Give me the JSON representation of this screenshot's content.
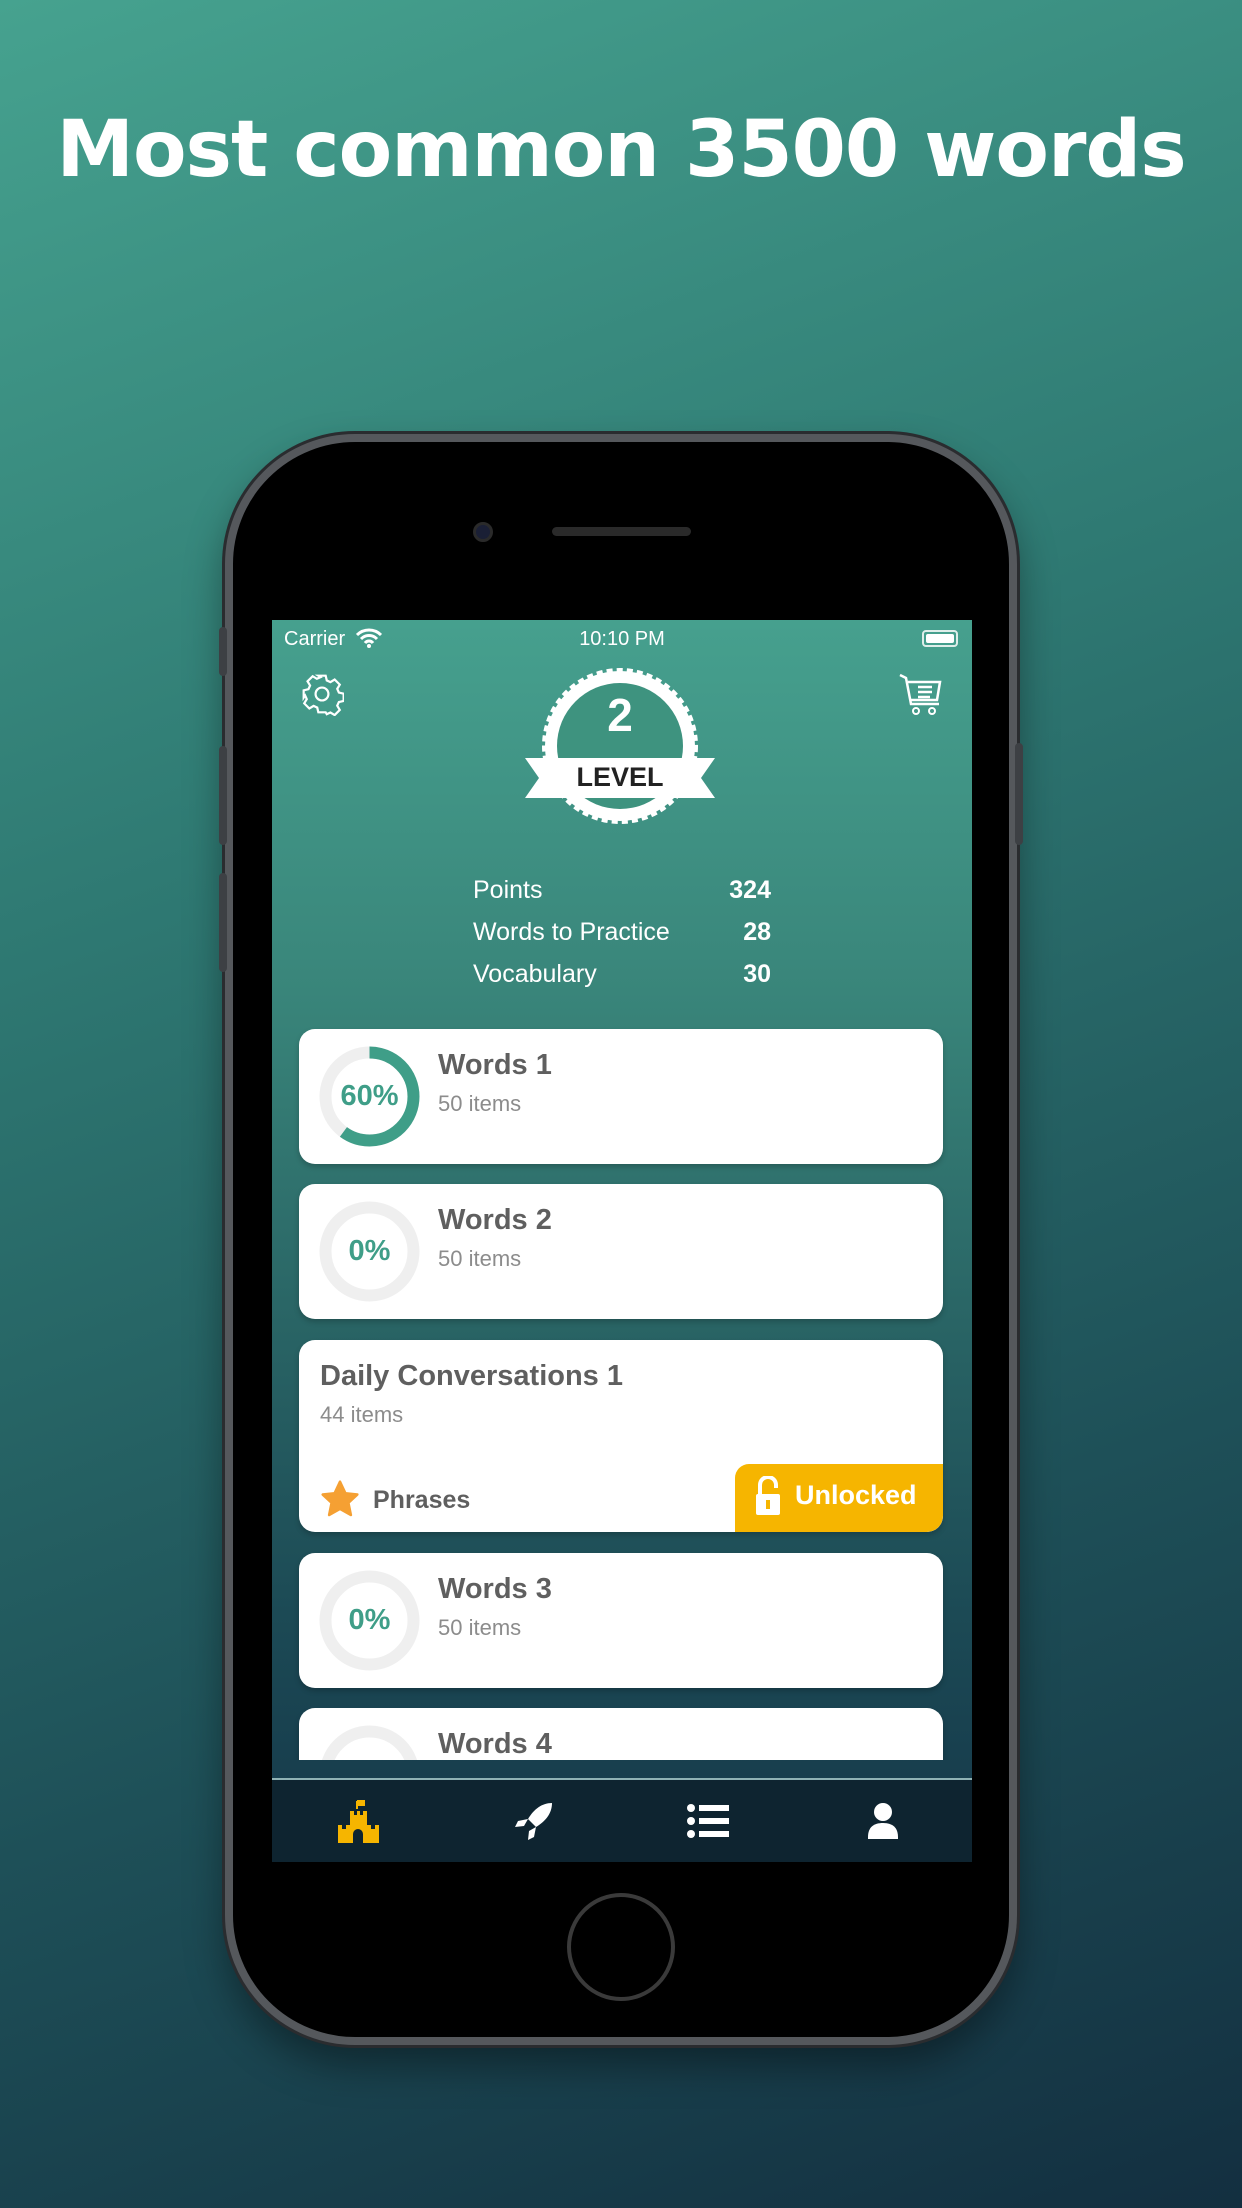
{
  "headline": "Most common 3500 words",
  "status": {
    "carrier": "Carrier",
    "time": "10:10 PM"
  },
  "level": {
    "number": "2",
    "label": "LEVEL"
  },
  "stats": [
    {
      "label": "Points",
      "value": "324"
    },
    {
      "label": "Words to Practice",
      "value": "28"
    },
    {
      "label": "Vocabulary",
      "value": "30"
    }
  ],
  "cards": [
    {
      "title": "Words 1",
      "subtitle": "50 items",
      "progress_label": "60%",
      "progress": 60
    },
    {
      "title": "Words 2",
      "subtitle": "50 items",
      "progress_label": "0%",
      "progress": 0
    },
    {
      "title": "Daily Conversations 1",
      "subtitle": "44 items",
      "category": "Phrases",
      "badge": "Unlocked"
    },
    {
      "title": "Words 3",
      "subtitle": "50 items",
      "progress_label": "0%",
      "progress": 0
    },
    {
      "title": "Words 4"
    }
  ],
  "tabs": [
    {
      "icon": "castle-icon",
      "active": true
    },
    {
      "icon": "rocket-icon"
    },
    {
      "icon": "list-icon"
    },
    {
      "icon": "user-icon"
    }
  ],
  "colors": {
    "accent": "#3f9e88",
    "badge": "#f6b500",
    "star": "#f5a033",
    "tab_active": "#f6b500"
  }
}
